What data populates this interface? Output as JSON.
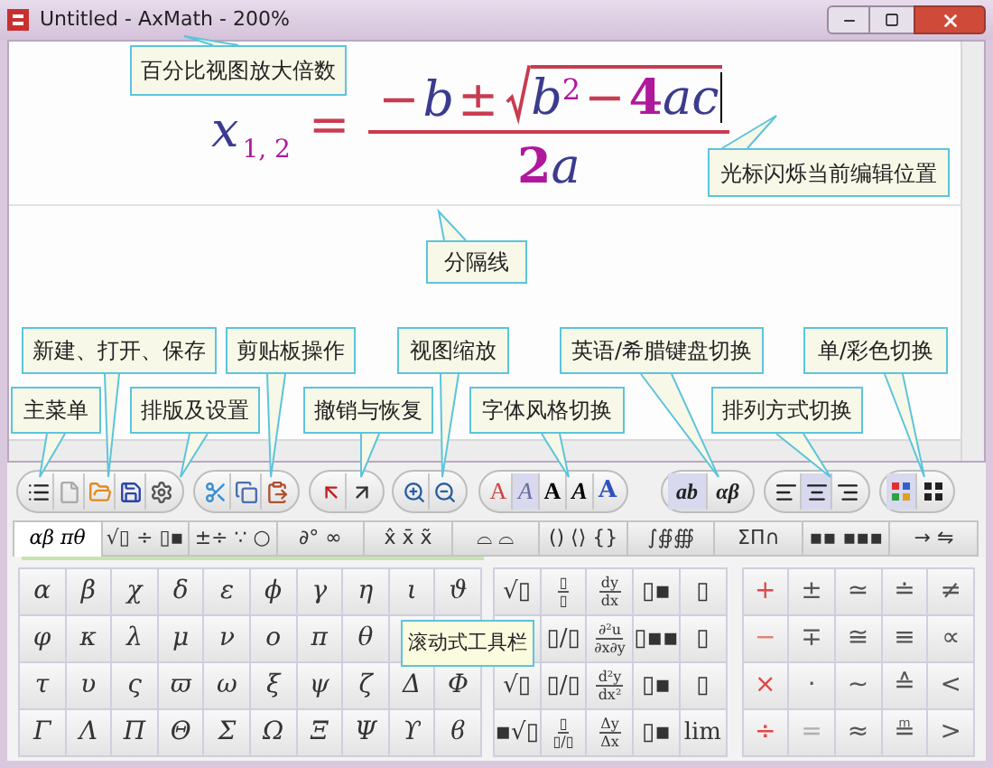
{
  "window": {
    "title": "Untitled - AxMath - 200%"
  },
  "equation": {
    "cursor_visible": true,
    "variable": {
      "text": "x",
      "color": "#3b3b8f"
    },
    "subscript": {
      "text": "1, 2",
      "color": "#b0189c"
    },
    "equals": {
      "text": "=",
      "color": "#c83c50"
    },
    "numerator": [
      {
        "text": "−",
        "kind": "op",
        "color": "#c83c50"
      },
      {
        "text": "b",
        "kind": "var",
        "color": "#3b3b8f"
      },
      {
        "text": "±",
        "kind": "op",
        "color": "#c83c50"
      }
    ],
    "radicand": [
      {
        "text": "b",
        "kind": "var",
        "color": "#3b3b8f"
      },
      {
        "text": "2",
        "kind": "sup",
        "color": "#b0189c"
      },
      {
        "text": "−",
        "kind": "op",
        "color": "#c83c50"
      },
      {
        "text": "4",
        "kind": "num",
        "color": "#b0189c"
      },
      {
        "text": "ac",
        "kind": "var",
        "color": "#3b3b8f"
      }
    ],
    "denominator": [
      {
        "text": "2",
        "kind": "num",
        "color": "#b0189c"
      },
      {
        "text": "a",
        "kind": "var",
        "color": "#3b3b8f"
      }
    ]
  },
  "callouts": [
    "百分比视图放大倍数",
    "光标闪烁当前编辑位置",
    "分隔线",
    "新建、打开、保存",
    "剪贴板操作",
    "视图缩放",
    "英语/希腊键盘切换",
    "单/彩色切换",
    "主菜单",
    "排版及设置",
    "撤销与恢复",
    "字体风格切换",
    "排列方式切换"
  ],
  "toolbar": [
    {
      "buttons": [
        {
          "kind": "menu"
        },
        {
          "kind": "new"
        },
        {
          "kind": "open"
        },
        {
          "kind": "save"
        },
        {
          "kind": "settings"
        }
      ]
    },
    {
      "buttons": [
        {
          "kind": "cut"
        },
        {
          "kind": "copy"
        },
        {
          "kind": "paste"
        }
      ]
    },
    {
      "buttons": [
        {
          "kind": "undo"
        },
        {
          "kind": "redo"
        }
      ]
    },
    {
      "buttons": [
        {
          "kind": "zoom-in"
        },
        {
          "kind": "zoom-out"
        }
      ]
    },
    {
      "buttons": [
        {
          "kind": "font-regular",
          "text": "A",
          "selected": false
        },
        {
          "kind": "font-italic",
          "text": "A",
          "selected": true
        },
        {
          "kind": "font-bold",
          "text": "A",
          "selected": false
        },
        {
          "kind": "font-bold-italic",
          "text": "A",
          "selected": false
        },
        {
          "kind": "font-outline",
          "text": "A",
          "selected": false
        }
      ]
    },
    {
      "buttons": [
        {
          "kind": "keyboard",
          "text": "ab",
          "selected": true
        },
        {
          "kind": "keyboard",
          "text": "αβ",
          "selected": false
        }
      ]
    },
    {
      "buttons": [
        {
          "kind": "align-left",
          "selected": false
        },
        {
          "kind": "align-center",
          "selected": true
        },
        {
          "kind": "align-right",
          "selected": false
        }
      ]
    },
    {
      "buttons": [
        {
          "kind": "color-grid",
          "selected": true
        },
        {
          "kind": "mono-grid",
          "selected": false
        }
      ]
    }
  ],
  "tabs": [
    {
      "label": "αβ πθ",
      "selected": true
    },
    {
      "label": "√▯ ÷ ▯▪",
      "selected": false
    },
    {
      "label": "±÷ ∵ ○",
      "selected": false
    },
    {
      "label": "∂° ∞",
      "selected": false
    },
    {
      "label": "x̂ x̄ x̃",
      "selected": false
    },
    {
      "label": "⌓ ⌓",
      "selected": false
    },
    {
      "label": "() ⟨⟩ {}",
      "selected": false
    },
    {
      "label": "∫∯∰",
      "selected": false
    },
    {
      "label": "ΣΠ∩",
      "selected": false
    },
    {
      "label": "▪▪ ▪▪▪",
      "selected": false
    },
    {
      "label": "→ ⇋",
      "selected": false
    }
  ],
  "palette": {
    "tooltip": "滚动式工具栏",
    "greek": [
      [
        "α",
        "β",
        "χ",
        "δ",
        "ε",
        "ϕ",
        "γ",
        "η",
        "ι",
        "ϑ"
      ],
      [
        "φ",
        "κ",
        "λ",
        "μ",
        "ν",
        "ο",
        "π",
        "θ"
      ],
      [
        "τ",
        "υ",
        "ς",
        "ϖ",
        "ω",
        "ξ",
        "ψ",
        "ζ",
        "Δ",
        "Φ"
      ],
      [
        "Γ",
        "Λ",
        "Π",
        "Θ",
        "Σ",
        "Ω",
        "Ξ",
        "Ψ",
        "ϒ",
        "ϐ"
      ]
    ],
    "templates": [
      [
        {
          "kind": "text",
          "text": "√▯"
        },
        {
          "kind": "frac",
          "num": "▯",
          "den": "▯"
        },
        {
          "kind": "frac",
          "num": "dy",
          "den": "dx"
        },
        {
          "kind": "text",
          "text": "▯▪"
        },
        {
          "kind": "text",
          "text": "▯"
        }
      ],
      [
        {
          "kind": "text",
          "text": "▯/▯"
        },
        {
          "kind": "frac",
          "num": "∂²u",
          "den": "∂x∂y"
        },
        {
          "kind": "text",
          "text": "▯▪▪"
        },
        {
          "kind": "text",
          "text": "▯"
        }
      ],
      [
        {
          "kind": "text",
          "text": "√▯"
        },
        {
          "kind": "text",
          "text": "▯/▯"
        },
        {
          "kind": "frac",
          "num": "d²y",
          "den": "dx²"
        },
        {
          "kind": "text",
          "text": "▯▪"
        },
        {
          "kind": "text",
          "text": "▯"
        }
      ],
      [
        {
          "kind": "text",
          "text": "▪√▯"
        },
        {
          "kind": "frac",
          "num": "▯",
          "den": "▯/▯"
        },
        {
          "kind": "frac",
          "num": "Δy",
          "den": "Δx"
        },
        {
          "kind": "text",
          "text": "▯▪"
        },
        {
          "kind": "text",
          "text": "lim"
        }
      ]
    ],
    "relations": [
      [
        {
          "text": "+",
          "color": "#e04848"
        },
        {
          "text": "±",
          "color": "#555555"
        },
        {
          "text": "≃",
          "color": "#555555"
        },
        {
          "text": "≐",
          "color": "#555555"
        },
        {
          "text": "≠",
          "color": "#555555"
        }
      ],
      [
        {
          "text": "−",
          "color": "#e08070"
        },
        {
          "text": "∓",
          "color": "#555555"
        },
        {
          "text": "≅",
          "color": "#555555"
        },
        {
          "text": "≡",
          "color": "#555555"
        },
        {
          "text": "∝",
          "color": "#555555"
        }
      ],
      [
        {
          "text": "×",
          "color": "#e04848"
        },
        {
          "text": "·",
          "color": "#555555"
        },
        {
          "text": "∼",
          "color": "#555555"
        },
        {
          "text": "≙",
          "color": "#555555"
        },
        {
          "text": "<",
          "color": "#555555"
        }
      ],
      [
        {
          "text": "÷",
          "color": "#e04848"
        },
        {
          "text": "=",
          "color": "#b0b0b0"
        },
        {
          "text": "≈",
          "color": "#555555"
        },
        {
          "text": "≞",
          "color": "#555555"
        },
        {
          "text": ">",
          "color": "#555555"
        }
      ]
    ]
  }
}
